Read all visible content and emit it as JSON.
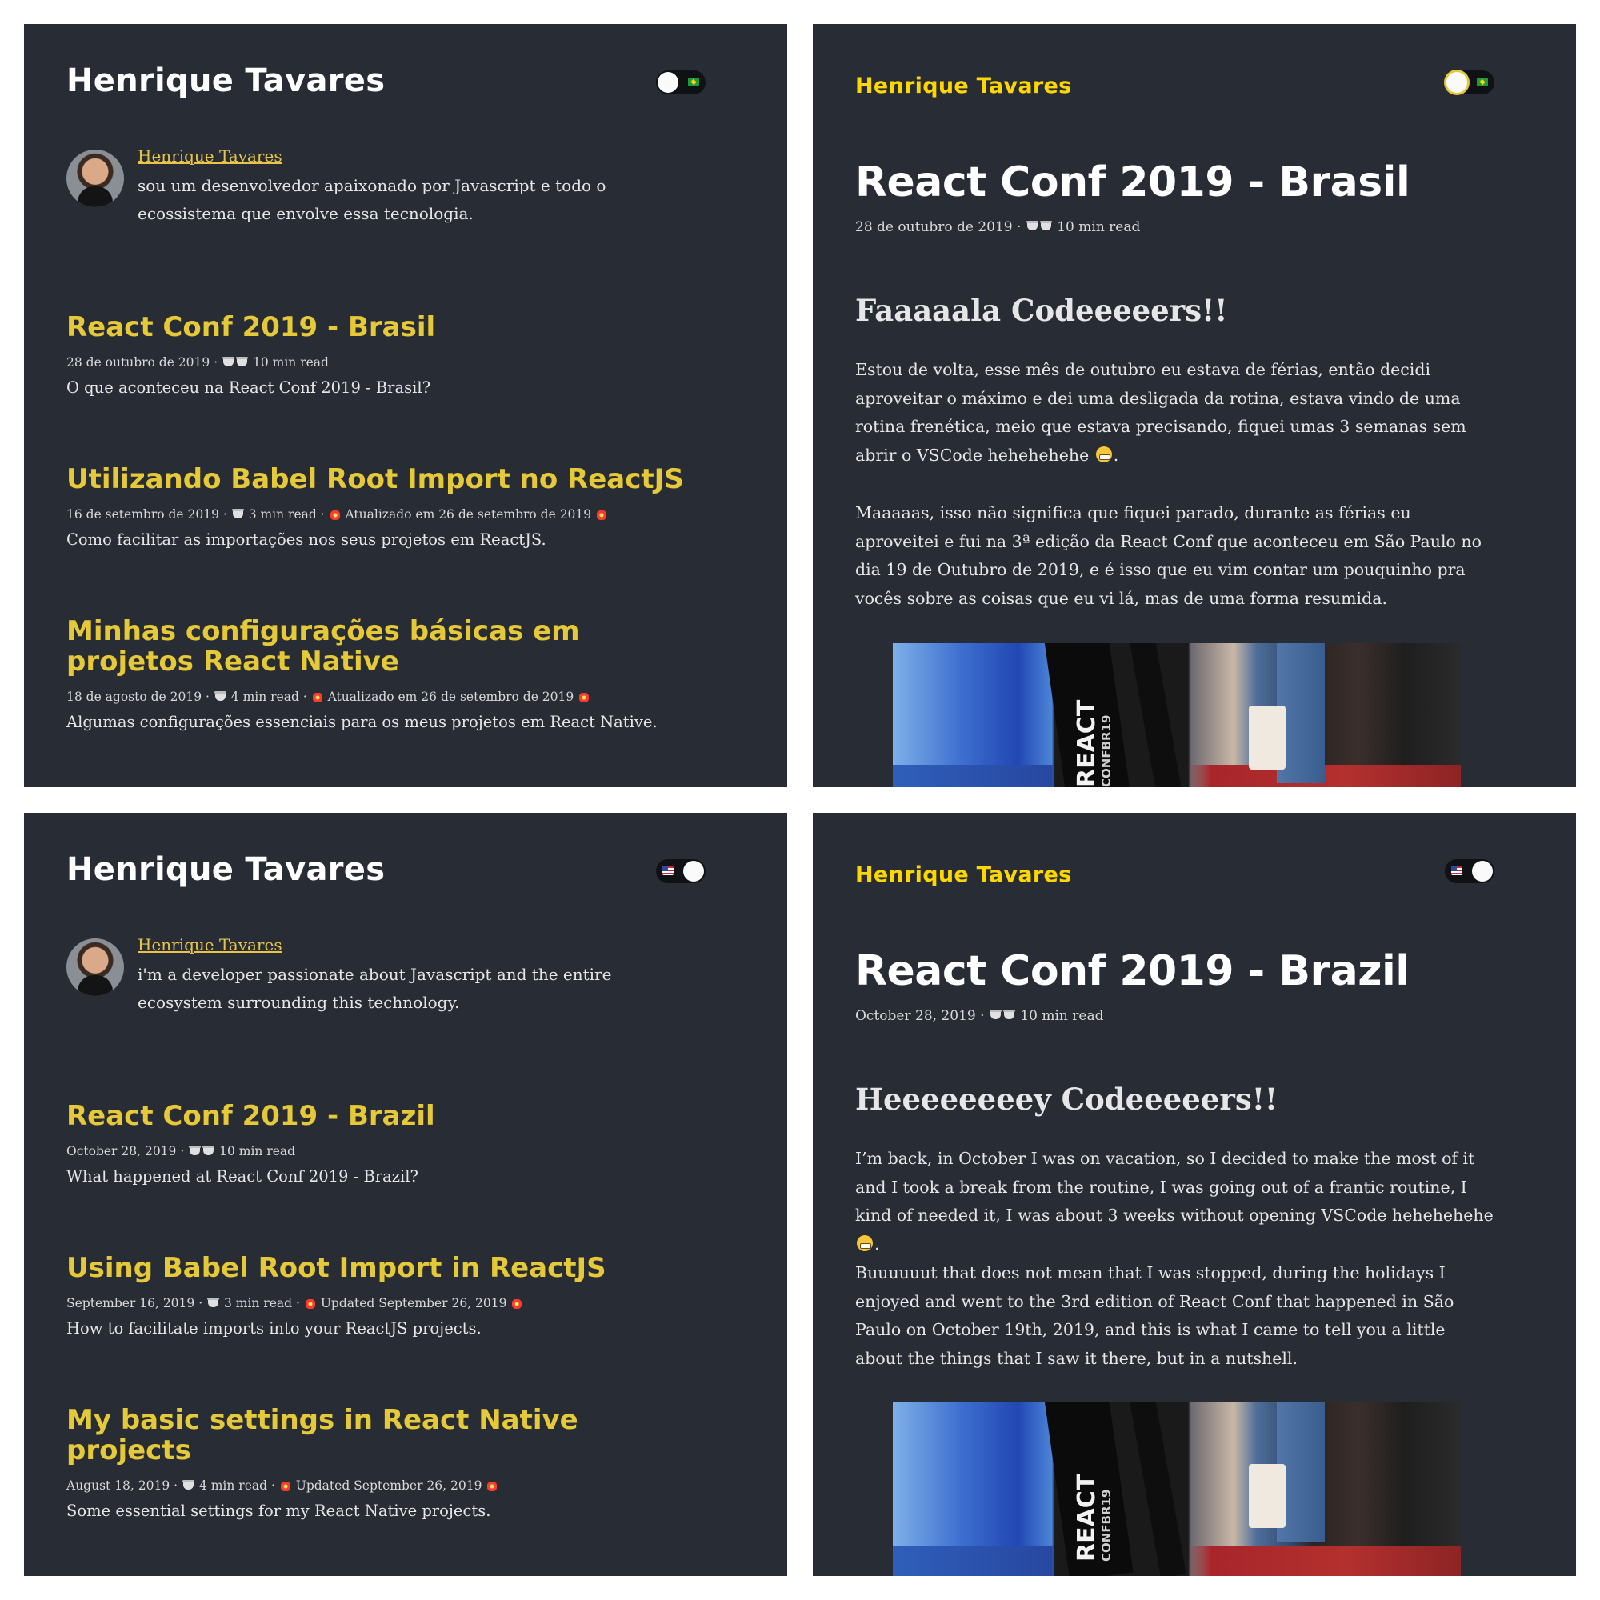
{
  "site": {
    "author": "Henrique Tavares"
  },
  "panel1": {
    "bio_name": "Henrique Tavares",
    "bio_text": "sou um desenvolvedor apaixonado por Javascript e todo o ecossistema que envolve essa tecnologia.",
    "posts": [
      {
        "title": "React Conf 2019 - Brasil",
        "date": "28 de outubro de 2019",
        "read": "10 min read",
        "updated": "",
        "excerpt": "O que aconteceu na React Conf 2019 - Brasil?"
      },
      {
        "title": "Utilizando Babel Root Import no ReactJS",
        "date": "16 de setembro de 2019",
        "read": "3 min read",
        "updated": "Atualizado em 26 de setembro de 2019",
        "excerpt": "Como facilitar as importações nos seus projetos em ReactJS."
      },
      {
        "title": "Minhas configurações básicas em projetos React Native",
        "date": "18 de agosto de 2019",
        "read": "4 min read",
        "updated": "Atualizado em 26 de setembro de 2019",
        "excerpt": "Algumas configurações essenciais para os meus projetos em React Native."
      }
    ]
  },
  "panel2": {
    "article_title": "React Conf 2019 - Brasil",
    "date": "28 de outubro de 2019",
    "read": "10 min read",
    "heading": "Faaaaala Codeeeeers!!",
    "p1": "Estou de volta, esse mês de outubro eu estava de férias, então decidi aproveitar o máximo e dei uma desligada da rotina, estava vindo de uma rotina frenética, meio que estava precisando, fiquei umas 3 semanas sem abrir o VSCode hehehehehe",
    "p2": "Maaaaas, isso não significa que fiquei parado, durante as férias eu aproveitei e fui na 3ª edição da React Conf que aconteceu em São Paulo no dia 19 de Outubro de 2019, e é isso que eu vim contar um pouquinho pra vocês sobre as coisas que eu vi lá, mas de uma forma resumida."
  },
  "panel3": {
    "bio_name": "Henrique Tavares",
    "bio_text": "i'm a developer passionate about Javascript and the entire ecosystem surrounding this technology.",
    "posts": [
      {
        "title": "React Conf 2019 - Brazil",
        "date": "October 28, 2019",
        "read": "10 min read",
        "updated": "",
        "excerpt": "What happened at React Conf 2019 - Brazil?"
      },
      {
        "title": "Using Babel Root Import in ReactJS",
        "date": "September 16, 2019",
        "read": "3 min read",
        "updated": "Updated September 26, 2019",
        "excerpt": "How to facilitate imports into your ReactJS projects."
      },
      {
        "title": "My basic settings in React Native projects",
        "date": "August 18, 2019",
        "read": "4 min read",
        "updated": "Updated September 26, 2019",
        "excerpt": "Some essential settings for my React Native projects."
      }
    ]
  },
  "panel4": {
    "article_title": "React Conf 2019 - Brazil",
    "date": "October 28, 2019",
    "read": "10 min read",
    "heading": "Heeeeeeeey Codeeeeers!!",
    "p1": "I’m back, in October I was on vacation, so I decided to make the most of it and I took a break from the routine, I was going out of a frantic routine, I kind of needed it, I was about 3 weeks without opening VSCode hehehehehe",
    "p2": "Buuuuuut that does not mean that I was stopped, during the holidays I enjoyed and went to the 3rd edition of React Conf that happened in São Paulo on October 19th, 2019, and this is what I came to tell you a little about the things that I saw it there, but in a nutshell."
  },
  "photo": {
    "lanyard_text": "REACT",
    "lanyard_sub": "CONFBR19"
  },
  "icons": {
    "coffee": "coffee-icon",
    "updated": "collision-icon",
    "grin": "grimacing-face-icon",
    "flag_pt": "brazil-flag-icon",
    "flag_en": "usa-flag-icon"
  },
  "colors": {
    "background": "#282c35",
    "accent": "#e6c938",
    "text": "#e6e6e6"
  }
}
